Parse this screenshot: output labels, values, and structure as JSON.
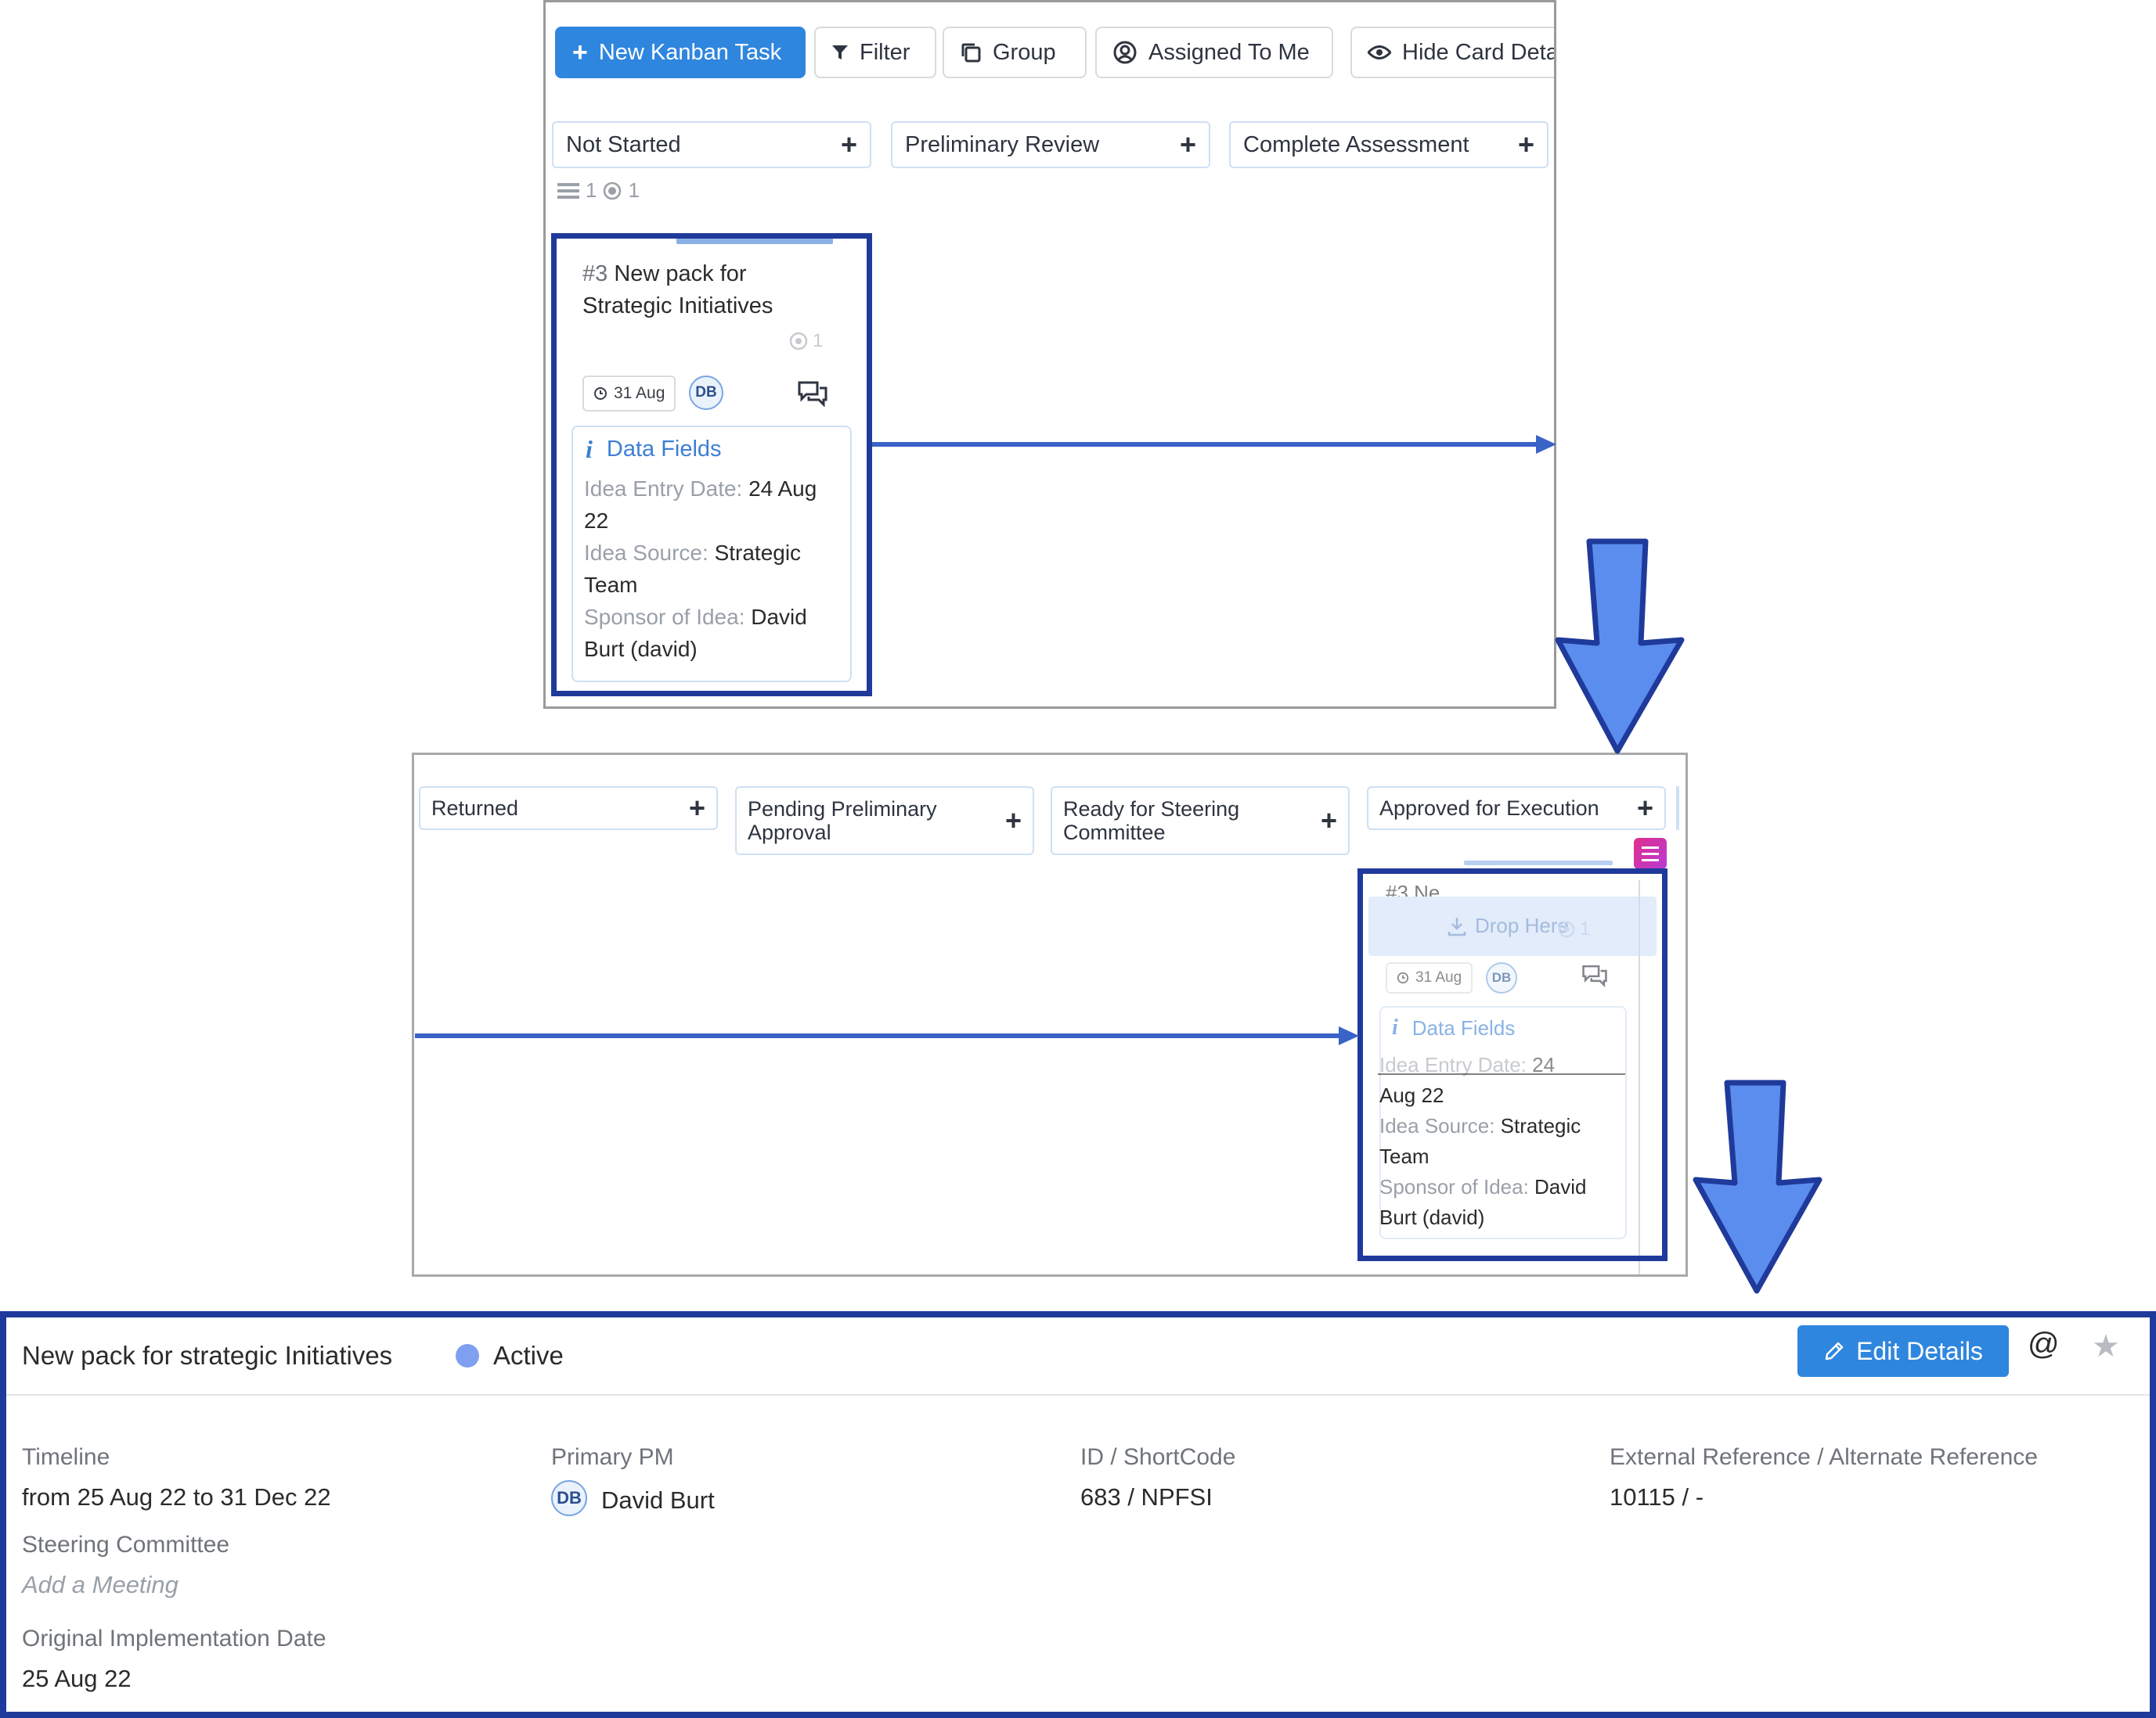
{
  "toolbar": {
    "new_task": "New Kanban Task",
    "filter": "Filter",
    "group": "Group",
    "assigned": "Assigned To Me",
    "hide_details": "Hide Card Deta"
  },
  "board1": {
    "columns": [
      "Not Started",
      "Preliminary Review",
      "Complete Assessment"
    ],
    "counts": [
      "1",
      "1"
    ]
  },
  "card": {
    "number": "#3",
    "title_line1": "New pack for",
    "title_line2": "Strategic Initiatives",
    "truncated_title": "#3 Ne...",
    "comment_count": "1",
    "due_date": "31 Aug",
    "assignee_initials": "DB",
    "data_fields_title": "Data Fields",
    "entry_label": "Idea Entry Date: ",
    "entry_value_a": "24 Aug",
    "entry_value_b": "22",
    "entry_value_short": "24",
    "entry_value_rest": "Aug 22",
    "source_label": "Idea Source: ",
    "source_value_a": "Strategic",
    "source_value_b": "Team",
    "sponsor_label": "Sponsor of Idea: ",
    "sponsor_value_a": "David",
    "sponsor_value_b": "Burt (david)",
    "drop_here": "Drop Here"
  },
  "board2": {
    "col_returned": "Returned",
    "col_pending_1": "Pending Preliminary",
    "col_pending_2": "Approval",
    "col_ready_1": "Ready for Steering",
    "col_ready_2": "Committee",
    "col_approved": "Approved for Execution"
  },
  "detail": {
    "title": "New pack for strategic Initiatives",
    "status": "Active",
    "edit_button": "Edit Details",
    "timeline_label": "Timeline",
    "timeline_value": "from 25 Aug 22 to 31 Dec 22",
    "steering_label": "Steering Committee",
    "steering_value": "Add a Meeting",
    "orig_label": "Original Implementation Date",
    "orig_value": "25 Aug 22",
    "pm_label": "Primary PM",
    "pm_initials": "DB",
    "pm_name": "David Burt",
    "id_label": "ID / ShortCode",
    "id_value": "683 / NPFSI",
    "ext_label": "External Reference / Alternate Reference",
    "ext_value": "10115 / -"
  },
  "colors": {
    "primary_button": "#2f86de",
    "highlight_frame": "#1f3a9a",
    "arrow_fill": "#5b8def",
    "status_dot": "#7f9ff0"
  },
  "icons": [
    "plus-icon",
    "filter-icon",
    "group-icon",
    "user-circle-icon",
    "eye-icon",
    "list-icon",
    "target-icon",
    "clock-icon",
    "chat-icon",
    "info-icon",
    "download-icon",
    "pencil-icon",
    "at-icon",
    "star-icon",
    "arrow-right-icon",
    "arrow-down-icon"
  ]
}
